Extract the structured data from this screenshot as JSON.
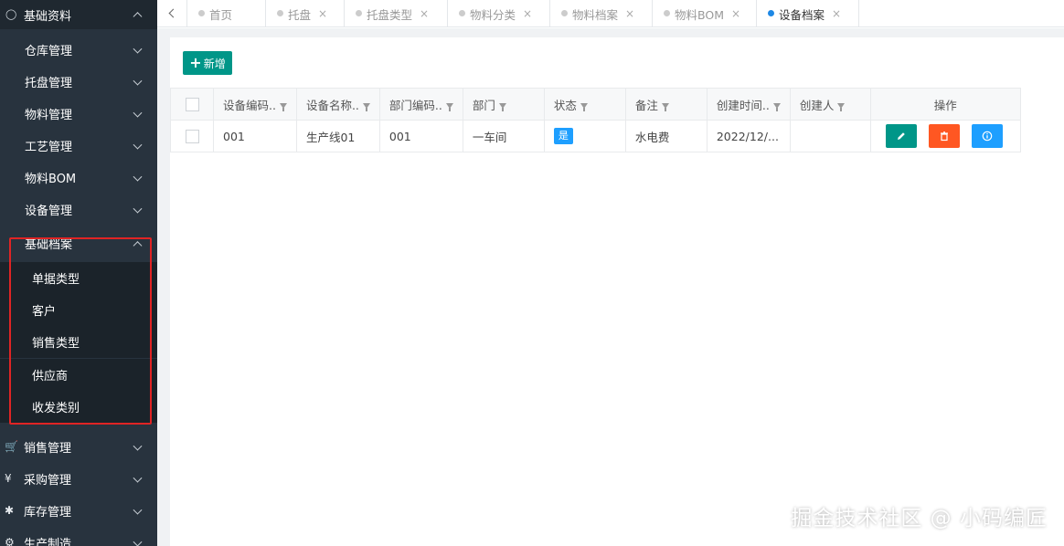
{
  "sidebar": {
    "top": {
      "label": "基础资料",
      "icon": "lightbulb-icon"
    },
    "items": [
      {
        "label": "仓库管理"
      },
      {
        "label": "托盘管理"
      },
      {
        "label": "物料管理"
      },
      {
        "label": "工艺管理"
      },
      {
        "label": "物料BOM"
      },
      {
        "label": "设备管理"
      },
      {
        "label": "基础档案"
      }
    ],
    "sub_items": [
      {
        "label": "单据类型"
      },
      {
        "label": "客户"
      },
      {
        "label": "销售类型"
      },
      {
        "label": "供应商"
      },
      {
        "label": "收发类别"
      }
    ],
    "bottom_items": [
      {
        "label": "销售管理",
        "icon": "cart-icon"
      },
      {
        "label": "采购管理",
        "icon": "yen-icon"
      },
      {
        "label": "库存管理",
        "icon": "asterisk-icon"
      },
      {
        "label": "生产制造",
        "icon": "gear-icon"
      }
    ]
  },
  "tabs": [
    {
      "label": "首页"
    },
    {
      "label": "托盘"
    },
    {
      "label": "托盘类型"
    },
    {
      "label": "物料分类"
    },
    {
      "label": "物料档案"
    },
    {
      "label": "物料BOM"
    },
    {
      "label": "设备档案",
      "active": true
    }
  ],
  "toolbar": {
    "add_label": "新增"
  },
  "table": {
    "headers": [
      "设备编码..",
      "设备名称..",
      "部门编码..",
      "部门",
      "状态",
      "备注",
      "创建时间..",
      "创建人",
      "操作"
    ],
    "rows": [
      {
        "code": "001",
        "name": "生产线01",
        "dept_code": "001",
        "dept": "一车间",
        "status": "是",
        "remark": "水电费",
        "created": "2022/12/...",
        "creator": ""
      }
    ]
  },
  "watermark": "掘金技术社区 @ 小码编匠"
}
